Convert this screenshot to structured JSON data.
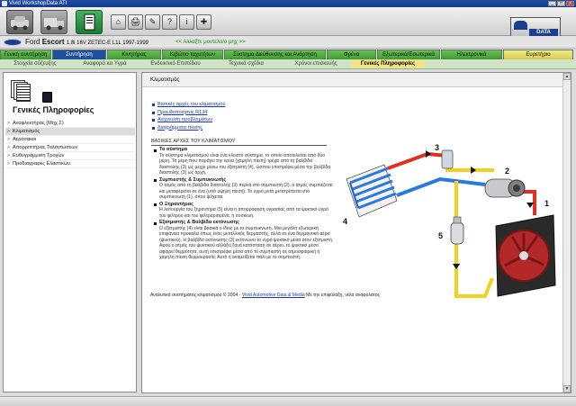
{
  "window": {
    "title": "Vivid WorkshopData ATI",
    "controls": [
      "_",
      "□",
      "x"
    ]
  },
  "toolbar": {
    "small_buttons": [
      "⌂",
      "🖨",
      "✎",
      "?",
      "i",
      "✚"
    ],
    "logo_text": "DATA"
  },
  "vehicle": {
    "make": "Ford",
    "model": "Escort",
    "details": "1.8i 16V ZETEC-E L1L 1997-1999",
    "change_link": "<< Αλλαξτε μοντελο/ο μηχ >>"
  },
  "main_tabs": [
    "Γενική συντήρηση",
    "Συντήρηση",
    "Κινητήρας",
    "Κιβώτιο ταχυτήτων",
    "Σύστημα Διεύθυνσης και Ανάρτηση",
    "Φρένα",
    "Εξωτερικά/Εσωτερικά",
    "Ηλεκτρονικά",
    "Ευρετήριο"
  ],
  "sub_tabs": [
    "Στοιχεία σύζευξης",
    "Αναφορά κει Υγρά",
    "Ενδεικτικό Επιπέδου",
    "Τεχνικά σχέδια",
    "Χρόνοι επισκευής",
    "Γενικές Πληροφορίες"
  ],
  "left_panel": {
    "title": "Γενικές Πληροφορίες",
    "items": [
      "Αναφλεκτήρας (Μηχ.Σ)",
      "Κλιματισμός",
      "Αερόσακοι",
      "Απορριπτήρας Ταλαντώσεων",
      "Ευθυγράμμιση Τροχών",
      "Προδιαγραφές Ελαστικών"
    ]
  },
  "content": {
    "header": "Κλιματισμός",
    "links": [
      "Βασικές αρχές του κλιματισμού",
      "Προειδοποιήσεις R134",
      "Ανίχνευση προβλημάτων",
      "Διαγράμματα πίεσης"
    ],
    "section_title": "ΒΑΣΙΚΕΣ ΑΡΧΕΣ ΤΟΥ ΚΛΙΜΑΤΙΣΜΟΥ",
    "sections": [
      {
        "title": "Το σύστημα",
        "text": "Το σύστημα κλιματισμού είναι ένα κλειστό σύστημα, το οποίο αποτελείται από δύο μέρη. Τα μέρη που παράγει την κρύα (χαμηλή πίεση) τρέχει από τη βαλβίδα διαστολής (3) ως μεχρι μέσω του εξατμιστή (4), ώσπου επιστρέφει μέσα την βαλβίδα διαστολής (3) ως αρχή."
      },
      {
        "title": "Συμπιεστής & Συμπυκνωτής",
        "text": "Ο ατμός από τη βαλβίδα διαστολής (3) περνά στο συμπιεστή (2), ο ατμός συμπιέζεται και μεταφέρεται σε ένα (υπό υψηλή πίεση). Το υγρό μετά μετατρέπεται στο συμπυκνωτή (1), όπου ψύχεται."
      },
      {
        "title": "Ο Ξηραντήρας",
        "text": "Η λειτουργία του ξηραντήρα (5) είναι η απορρόφηση υγρασίας από τα ψυκτικό υγρό του φίλτρου και του φιλτραρισμένα, η συσκευή."
      },
      {
        "title": "Εξατμιστής & Βαλβίδα εκτόνωσης",
        "text": "Ο εξατμιστής (4) είναι βασικά ο ίδιος με το συμπυκνωτή. Μια μεγάλη εξωτερική επιφάνεια προκαλεί όπως ένας μεταλλικός θερμαστής, αλλά σε ένα θερμαντικό αέρα (ψυκτικού). Η βαλβίδα εκτόνωσης (3) εκτονώνει το υγρό ψυκτικό μέσα στον εξατμιστή. Αφού ο ατμός του ψυκτικού αλλάξει ξανά κατάσταση σε αέριο, το ψυκτικό μέσο αφαιρεί θερμότητα, αυτή επιστρέφει μέσα από το συμπιεστή σε ατμοσφαιρική ή χαμηλή πίεση θερμοκρασία, Αυτό η αναμείξεται πάλι με το συμπιεστή."
      }
    ],
    "footnote_prefix": "Αναλυτικά συστήματος κλιματισμού © 2004 -",
    "footnote_link": "Vivid Automotive Data & Media",
    "footnote_suffix": "Με την επιφύλαξη, νέλα αναφύλατος"
  },
  "diagram": {
    "labels": [
      "1",
      "2",
      "3",
      "4",
      "5"
    ]
  }
}
